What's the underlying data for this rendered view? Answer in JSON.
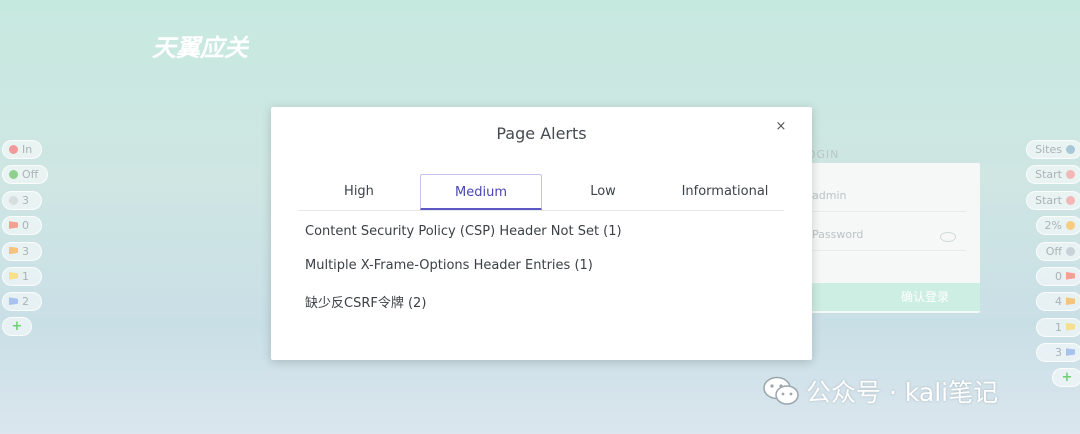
{
  "logo_text": "天翼应关",
  "login": {
    "title": "LOGIN",
    "username_placeholder": "admin",
    "password_placeholder": "Password",
    "submit_label": "确认登录"
  },
  "left_toolbar": [
    {
      "label": "In",
      "icon": "red-dot-icon",
      "color": "#f29a9a"
    },
    {
      "label": "Off",
      "icon": "green-dot-icon",
      "color": "#8fd08f"
    },
    {
      "label": "3",
      "icon": "bulb-icon",
      "color": "#d8dde0"
    },
    {
      "label": "0",
      "icon": "red-flag-icon",
      "color": "#f2a08f"
    },
    {
      "label": "3",
      "icon": "orange-flag-icon",
      "color": "#f6c27f"
    },
    {
      "label": "1",
      "icon": "yellow-flag-icon",
      "color": "#f6e08a"
    },
    {
      "label": "2",
      "icon": "blue-flag-icon",
      "color": "#a8c2ee"
    }
  ],
  "right_toolbar": [
    {
      "label": "Sites",
      "icon": "globe-icon",
      "color": "#a8c8d8"
    },
    {
      "label": "Start",
      "icon": "spider-icon",
      "color": "#f2b8b8"
    },
    {
      "label": "Start",
      "icon": "spider-icon",
      "color": "#f2b8b8"
    },
    {
      "label": "2%",
      "icon": "flame-icon",
      "color": "#f6cc7f"
    },
    {
      "label": "Off",
      "icon": "life-ring-icon",
      "color": "#c8d2d8"
    },
    {
      "label": "0",
      "icon": "red-flag-icon",
      "color": "#f2a08f"
    },
    {
      "label": "4",
      "icon": "orange-flag-icon",
      "color": "#f6c27f"
    },
    {
      "label": "1",
      "icon": "yellow-flag-icon",
      "color": "#f6e08a"
    },
    {
      "label": "3",
      "icon": "blue-flag-icon",
      "color": "#a8c2ee"
    }
  ],
  "modal": {
    "title": "Page Alerts",
    "close_label": "×",
    "tabs": [
      "High",
      "Medium",
      "Low",
      "Informational"
    ],
    "active_tab": "Medium",
    "alerts": [
      "Content Security Policy (CSP) Header Not Set (1)",
      "Multiple X-Frame-Options Header Entries (1)",
      "缺少反CSRF令牌 (2)"
    ]
  },
  "watermark": "公众号 · kali笔记",
  "colors": {
    "accent": "#5b57c4",
    "tab_active_border": "#c7c3ee",
    "add_green": "#6ecf73"
  }
}
